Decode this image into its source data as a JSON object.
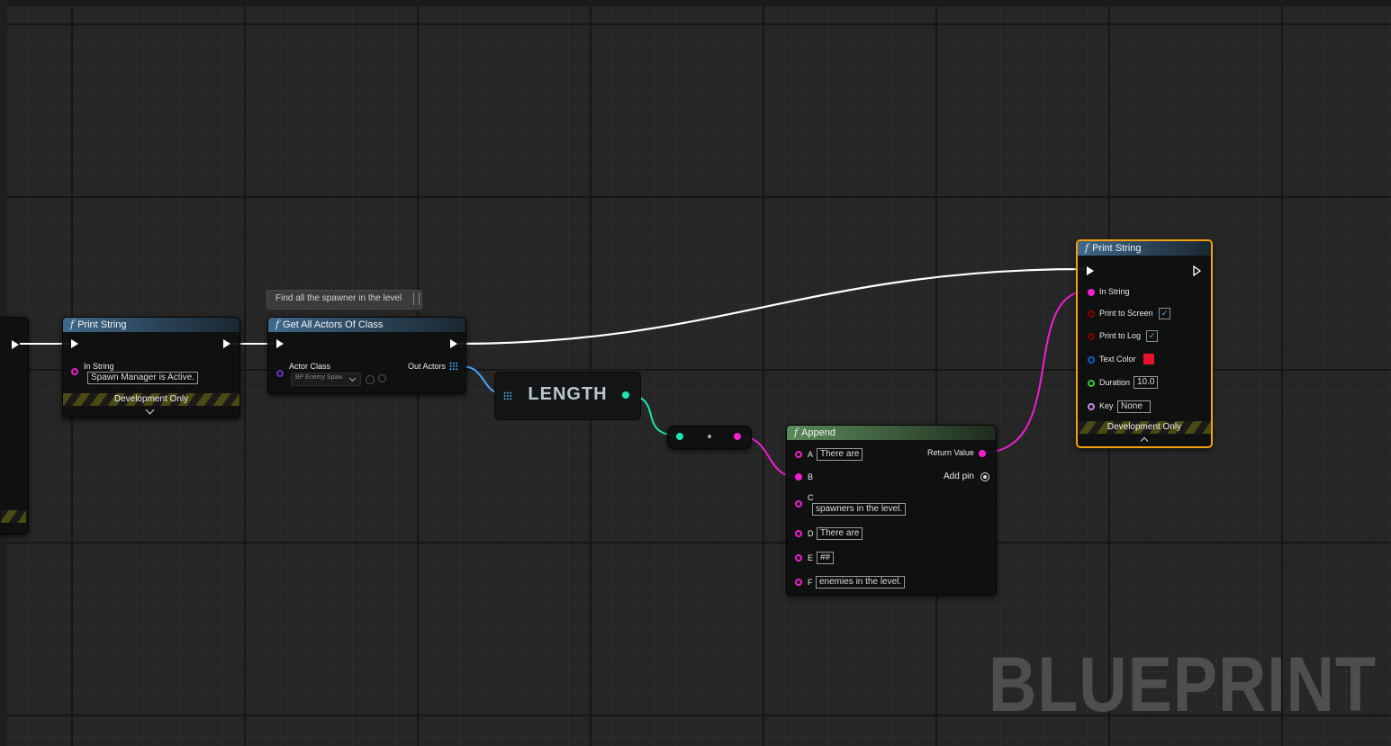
{
  "comment": {
    "text": "Find all the spawner in the level"
  },
  "node_print1": {
    "title": "Print String",
    "in_string_label": "In String",
    "in_string_value": "Spawn Manager is Active.",
    "dev_only": "Development Only"
  },
  "node_getall": {
    "title": "Get All Actors Of Class",
    "actor_class_label": "Actor Class",
    "actor_class_value": "BP Enemy Spaw",
    "out_actors_label": "Out Actors"
  },
  "node_length": {
    "title": "LENGTH"
  },
  "node_append": {
    "title": "Append",
    "return_label": "Return Value",
    "add_pin_label": "Add pin",
    "pins": [
      {
        "letter": "A",
        "value": "There are"
      },
      {
        "letter": "B",
        "value": ""
      },
      {
        "letter": "C",
        "value": "spawners in the level."
      },
      {
        "letter": "D",
        "value": "There are"
      },
      {
        "letter": "E",
        "value": "##"
      },
      {
        "letter": "F",
        "value": "enemies in the level."
      }
    ]
  },
  "node_print2": {
    "title": "Print String",
    "in_string_label": "In String",
    "print_to_screen_label": "Print to Screen",
    "print_to_log_label": "Print to Log",
    "text_color_label": "Text Color",
    "duration_label": "Duration",
    "duration_value": "10.0",
    "key_label": "Key",
    "key_value": "None",
    "dev_only": "Development Only",
    "text_color_hex": "#e8102a"
  },
  "watermark": "BLUEPRINT",
  "colors": {
    "exec": "#ffffff",
    "string_pin": "#f01fd0",
    "int_pin": "#1ee3b5",
    "object_pin": "#3ea7ff",
    "class_pin": "#6a2cc4",
    "bool_pin": "#8a0000",
    "struct_pin": "#0b5fcc",
    "float_pin": "#32cd32",
    "name_pin": "#c28ee8",
    "selection": "#f5a10d"
  }
}
